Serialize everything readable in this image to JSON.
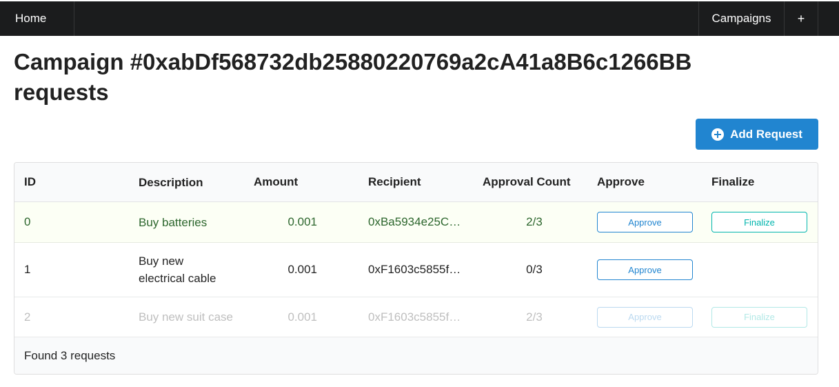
{
  "nav": {
    "home": "Home",
    "campaigns": "Campaigns",
    "plus": "+"
  },
  "page": {
    "title": "Campaign #0xabDf568732db25880220769a2cA41a8B6c1266BB requests",
    "add_request_label": "Add Request"
  },
  "table": {
    "headers": {
      "id": "ID",
      "description": "Description",
      "amount": "Amount",
      "recipient": "Recipient",
      "approval_count": "Approval Count",
      "approve": "Approve",
      "finalize": "Finalize"
    },
    "rows": [
      {
        "id": "0",
        "description": "Buy batteries",
        "amount": "0.001",
        "recipient": "0xBa5934e25C…",
        "approval_count": "2/3",
        "approve_label": "Approve",
        "finalize_label": "Finalize",
        "status": "positive"
      },
      {
        "id": "1",
        "description": "Buy new electrical cable",
        "amount": "0.001",
        "recipient": "0xF1603c5855f…",
        "approval_count": "0/3",
        "approve_label": "Approve",
        "status": "normal"
      },
      {
        "id": "2",
        "description": "Buy new suit case",
        "amount": "0.001",
        "recipient": "0xF1603c5855f…",
        "approval_count": "2/3",
        "approve_label": "Approve",
        "finalize_label": "Finalize",
        "status": "disabled"
      }
    ],
    "footer": "Found 3 requests"
  },
  "colors": {
    "nav_bg": "#1b1c1d",
    "primary": "#2185d0",
    "teal": "#00b5ad",
    "positive_bg": "#fcfff5",
    "positive_text": "#2c662d"
  },
  "icons": {
    "add_request": "plus-circle-icon"
  }
}
